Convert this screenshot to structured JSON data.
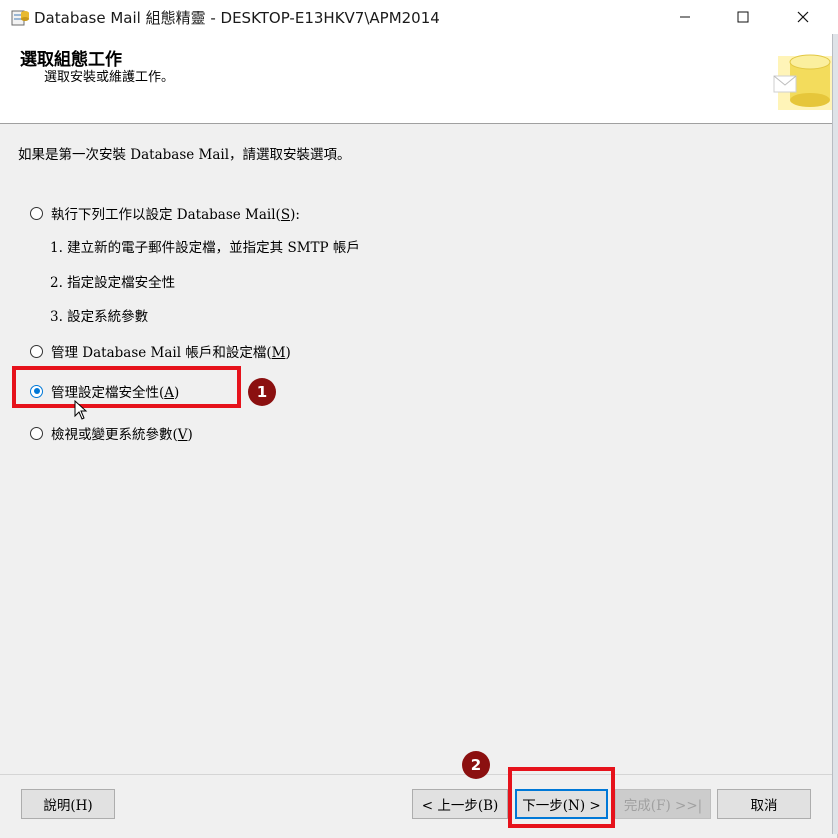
{
  "window": {
    "title": "Database Mail 組態精靈 - DESKTOP-E13HKV7\\APM2014",
    "controls": {
      "minimize": "—",
      "maximize": "☐",
      "close": "✕"
    }
  },
  "header": {
    "title": "選取組態工作",
    "subtitle": "選取安裝或維護工作。"
  },
  "content": {
    "intro": "如果是第一次安裝 Database Mail，請選取安裝選項。",
    "options": [
      {
        "label_main": "執行下列工作以設定 Database Mail(",
        "mnemonic": "S",
        "label_end": "):",
        "checked": false
      },
      {
        "label_main": "管理 Database Mail 帳戶和設定檔(",
        "mnemonic": "M",
        "label_end": ")",
        "checked": false
      },
      {
        "label_main": "管理設定檔安全性(",
        "mnemonic": "A",
        "label_end": ")",
        "checked": true
      },
      {
        "label_main": "檢視或變更系統參數(",
        "mnemonic": "V",
        "label_end": ")",
        "checked": false
      }
    ],
    "steps": [
      "1. 建立新的電子郵件設定檔，並指定其 SMTP 帳戶",
      "2. 指定設定檔安全性",
      "3. 設定系統參數"
    ]
  },
  "annotations": {
    "badge1": "1",
    "badge2": "2",
    "color": "#e6121b",
    "badge_color": "#8b1010"
  },
  "buttons": {
    "help": "說明(H)",
    "back": "< 上一步(B)",
    "next": "下一步(N) >",
    "finish": "完成(F) >>|",
    "cancel": "取消"
  }
}
